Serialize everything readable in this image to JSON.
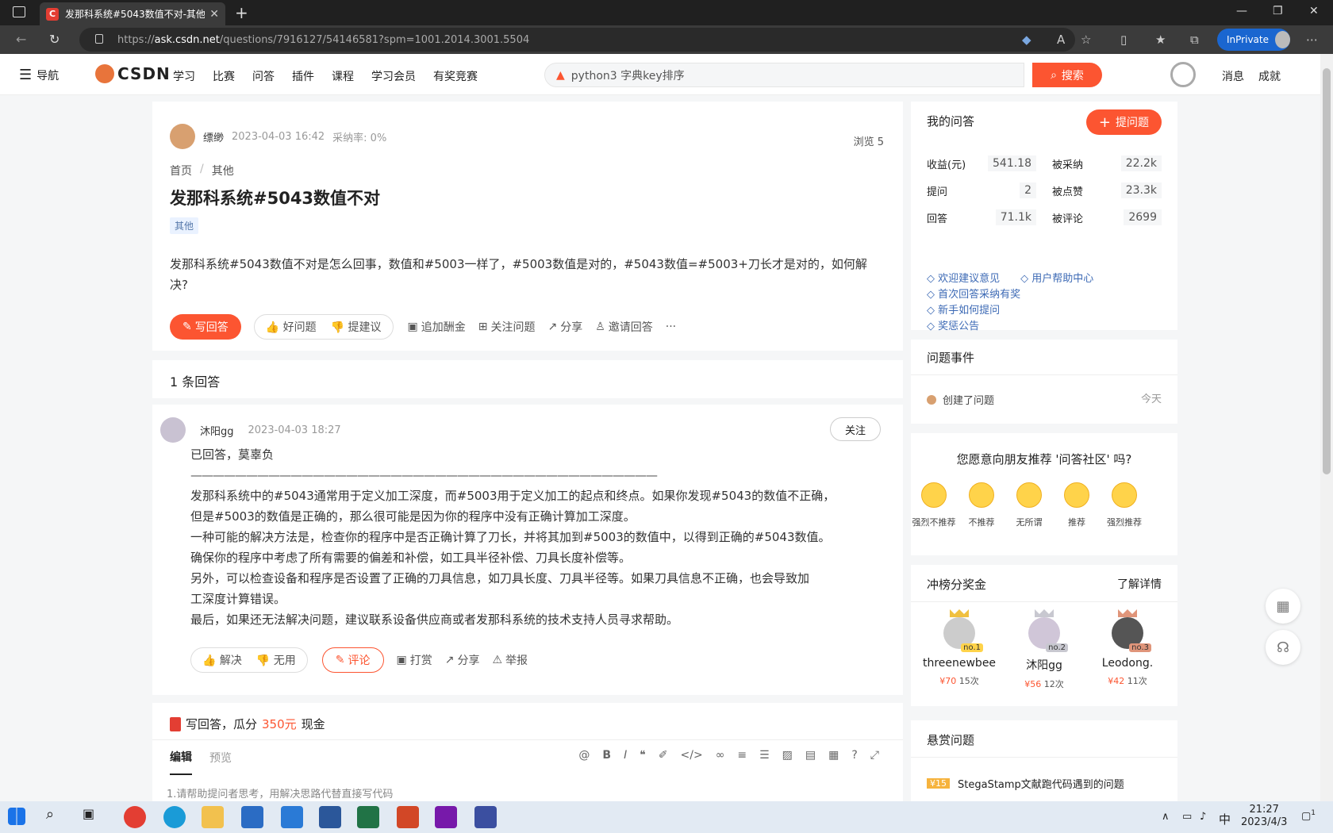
{
  "browser": {
    "tab_title": "发那科系统#5043数值不对-其他",
    "tab_favicon": "C",
    "url_prefix": "https://",
    "url_host": "ask.csdn.net",
    "url_path": "/questions/7916127/54146581?spm=1001.2014.3001.5504",
    "inprivate_label": "InPrivate"
  },
  "topnav": {
    "menu_label": "导航",
    "logo_text": "CSDN",
    "links": [
      "学习",
      "比赛",
      "问答",
      "插件",
      "课程",
      "学习会员",
      "有奖竞赛"
    ],
    "search_value": "python3 字典key排序",
    "search_button": "搜索",
    "messages": "消息",
    "achievements": "成就"
  },
  "question": {
    "author": "缥缈",
    "date": "2023-04-03 16:42",
    "accept_rate": "采纳率: 0%",
    "views": "浏览 5",
    "breadcrumb": [
      "首页",
      "/",
      "其他"
    ],
    "title": "发那科系统#5043数值不对",
    "tag": "其他",
    "body": "发那科系统#5043数值不对是怎么回事，数值和#5003一样了，#5003数值是对的，#5043数值=#5003+刀长才是对的，如何解决?",
    "actions": {
      "write_answer": "写回答",
      "good_question": "好问题",
      "suggest": "提建议",
      "add_bounty": "追加酬金",
      "follow": "关注问题",
      "share": "分享",
      "invite": "邀请回答",
      "more": "···"
    }
  },
  "answers_count": "1 条回答",
  "answer": {
    "author": "沐阳gg",
    "date": "2023-04-03 18:27",
    "follow_button": "关注",
    "lines": [
      "已回答，莫辜负",
      "——————————————————————————————————————————",
      "发那科系统中的#5043通常用于定义加工深度，而#5003用于定义加工的起点和终点。如果你发现#5043的数值不正确，",
      "但是#5003的数值是正确的，那么很可能是因为你的程序中没有正确计算加工深度。",
      "一种可能的解决方法是，检查你的程序中是否正确计算了刀长，并将其加到#5003的数值中，以得到正确的#5043数值。",
      "确保你的程序中考虑了所有需要的偏差和补偿，如工具半径补偿、刀具长度补偿等。",
      "另外，可以检查设备和程序是否设置了正确的刀具信息，如刀具长度、刀具半径等。如果刀具信息不正确，也会导致加",
      "工深度计算错误。",
      "最后，如果还无法解决问题，建议联系设备供应商或者发那科系统的技术支持人员寻求帮助。"
    ],
    "actions": {
      "solve": "解决",
      "useless": "无用",
      "comment": "评论",
      "tip": "打赏",
      "share": "分享",
      "report": "举报"
    }
  },
  "write_panel": {
    "prefix": "写回答，瓜分",
    "amount": "350元",
    "suffix": "现金",
    "tab_edit": "编辑",
    "tab_preview": "预览",
    "placeholder": "1.请帮助提问者思考，用解决思路代替直接写代码"
  },
  "sidebar": {
    "my_qa": "我的问答",
    "ask_button": "提问题",
    "stats": [
      {
        "label": "收益(元)",
        "value": "541.18"
      },
      {
        "label": "被采纳",
        "value": "22.2k"
      },
      {
        "label": "提问",
        "value": "2"
      },
      {
        "label": "被点赞",
        "value": "23.3k"
      },
      {
        "label": "回答",
        "value": "71.1k"
      },
      {
        "label": "被评论",
        "value": "2699"
      }
    ],
    "links": [
      "欢迎建议意见",
      "用户帮助中心",
      "首次回答采纳有奖",
      "新手如何提问",
      "奖惩公告"
    ],
    "events_title": "问题事件",
    "event_text": "创建了问题",
    "event_time": "今天",
    "recommend_title": "您愿意向朋友推荐 '问答社区' 吗?",
    "faces": [
      "强烈不推荐",
      "不推荐",
      "无所谓",
      "推荐",
      "强烈推荐"
    ],
    "rank_title": "冲榜分奖金",
    "rank_more": "了解详情",
    "ranks": [
      {
        "no": "no.1",
        "name": "threenewbee",
        "amount": "¥70",
        "times": "15次"
      },
      {
        "no": "no.2",
        "name": "沐阳gg",
        "amount": "¥56",
        "times": "12次"
      },
      {
        "no": "no.3",
        "name": "Leodong.",
        "amount": "¥42",
        "times": "11次"
      }
    ],
    "bounty_title": "悬赏问题",
    "bounty_badge": "¥15",
    "bounty_item": "StegaStamp文献跑代码遇到的问题"
  },
  "taskbar": {
    "time": "21:27",
    "date": "2023/4/3",
    "ime": "中",
    "notifications": "1"
  },
  "colors": {
    "accent": "#fc5531",
    "link": "#3d6ab5"
  }
}
